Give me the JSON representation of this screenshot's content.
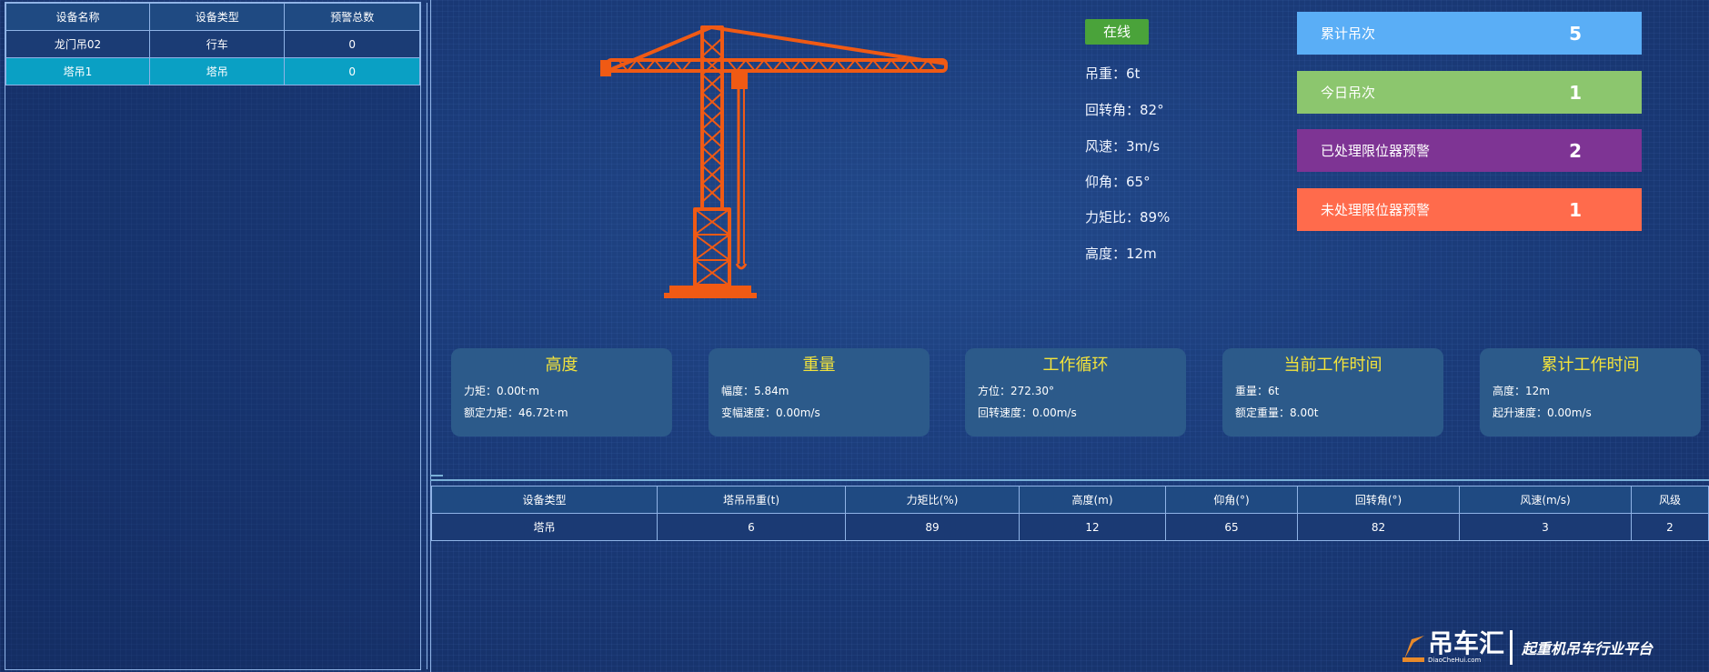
{
  "device_table": {
    "headers": [
      "设备名称",
      "设备类型",
      "预警总数"
    ],
    "rows": [
      {
        "name": "龙门吊02",
        "type": "行车",
        "alerts": "0"
      },
      {
        "name": "塔吊1",
        "type": "塔吊",
        "alerts": "0"
      }
    ]
  },
  "status": {
    "label": "在线",
    "color": "#4aa33a"
  },
  "metrics": [
    "吊重：6t",
    "回转角：82°",
    "风速：3m/s",
    "仰角：65°",
    "力矩比：89%",
    "高度：12m"
  ],
  "counters": [
    {
      "label": "累计吊次",
      "value": "5",
      "color": "#5aaef6"
    },
    {
      "label": "今日吊次",
      "value": "1",
      "color": "#8cc66e"
    },
    {
      "label": "已处理限位器预警",
      "value": "2",
      "color": "#7e3494"
    },
    {
      "label": "未处理限位器预警",
      "value": "1",
      "color": "#ff6b4c"
    }
  ],
  "cards": [
    {
      "title": "高度",
      "line1": "力矩：0.00t·m",
      "line2": "额定力矩：46.72t·m"
    },
    {
      "title": "重量",
      "line1": "幅度：5.84m",
      "line2": "变幅速度：0.00m/s"
    },
    {
      "title": "工作循环",
      "line1": "方位：272.30°",
      "line2": "回转速度：0.00m/s"
    },
    {
      "title": "当前工作时间",
      "line1": "重量：6t",
      "line2": "额定重量：8.00t"
    },
    {
      "title": "累计工作时间",
      "line1": "高度：12m",
      "line2": "起升速度：0.00m/s"
    }
  ],
  "data_table": {
    "headers": [
      "设备类型",
      "塔吊吊重(t)",
      "力矩比(%)",
      "高度(m)",
      "仰角(°)",
      "回转角(°)",
      "风速(m/s)",
      "风级"
    ],
    "row": [
      "塔吊",
      "6",
      "89",
      "12",
      "65",
      "82",
      "3",
      "2"
    ]
  },
  "crane_color": "#f05a14",
  "logo": {
    "brand": "吊车汇",
    "domain": "DiaoCheHui.com",
    "slogan": "起重机吊车行业平台"
  }
}
